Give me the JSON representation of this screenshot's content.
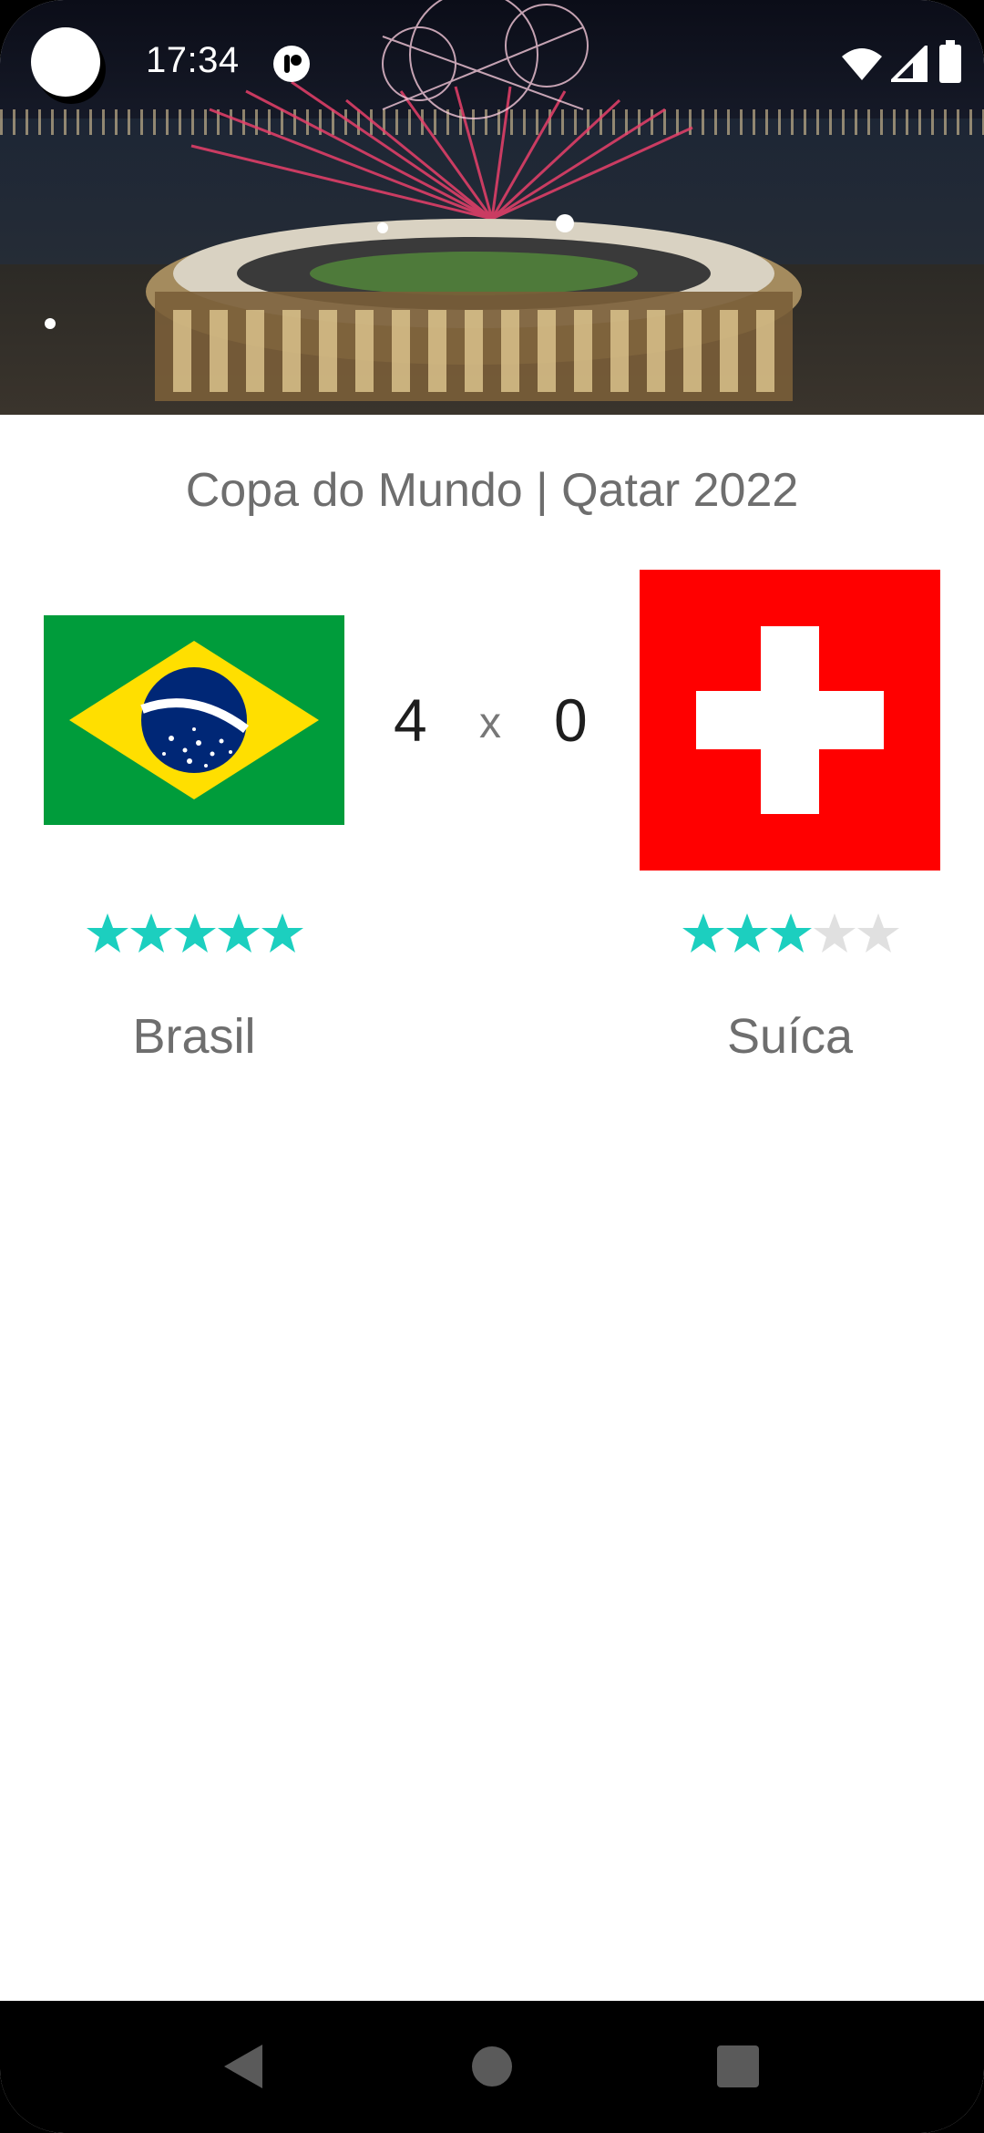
{
  "status_bar": {
    "time": "17:34",
    "icons": [
      "camera-cutout",
      "notification-app-icon",
      "wifi-icon",
      "cellular-signal-icon",
      "battery-icon"
    ]
  },
  "hero": {
    "image": "stadium-with-fireworks"
  },
  "match": {
    "tournament": "Copa do Mundo | Qatar 2022",
    "home": {
      "name": "Brasil",
      "score": "4",
      "rating": 5,
      "rating_max": 5,
      "flag": "brazil-flag"
    },
    "separator": "x",
    "away": {
      "name": "Suíca",
      "score": "0",
      "rating": 3,
      "rating_max": 5,
      "flag": "switzerland-flag"
    }
  },
  "colors": {
    "star_filled": "#1ccfbf",
    "star_empty": "#e0e0e0",
    "brazil_green": "#009c3b",
    "brazil_yellow": "#ffdf00",
    "brazil_blue": "#002776",
    "swiss_red": "#ff0000"
  },
  "navigation": {
    "buttons": [
      "back-icon",
      "home-icon",
      "recents-icon"
    ]
  }
}
